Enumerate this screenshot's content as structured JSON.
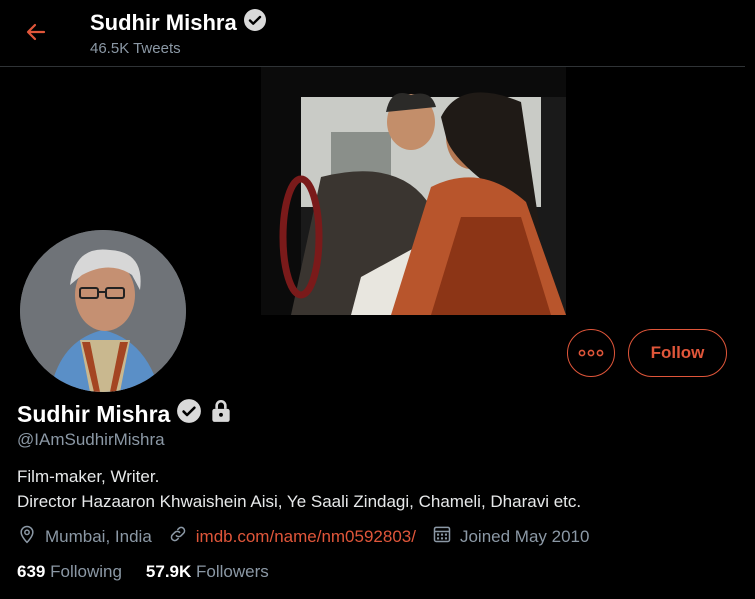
{
  "header": {
    "name": "Sudhir Mishra",
    "tweet_count": "46.5K Tweets"
  },
  "profile": {
    "name": "Sudhir Mishra",
    "handle": "@IAmSudhirMishra",
    "bio_line1": "Film-maker, Writer.",
    "bio_line2": "Director Hazaaron Khwaishein Aisi, Ye Saali Zindagi, Chameli, Dharavi etc.",
    "location": "Mumbai, India",
    "website": "imdb.com/name/nm0592803/",
    "joined": "Joined May 2010"
  },
  "actions": {
    "follow_label": "Follow"
  },
  "stats": {
    "following_count": "639",
    "following_label": "Following",
    "followers_count": "57.9K",
    "followers_label": "Followers"
  },
  "colors": {
    "accent": "#e0563a",
    "background": "#000000",
    "secondary_text": "#8b98a5"
  },
  "icons": [
    "back-arrow-icon",
    "verified-icon",
    "lock-icon",
    "more-icon",
    "location-icon",
    "link-icon",
    "calendar-icon"
  ]
}
